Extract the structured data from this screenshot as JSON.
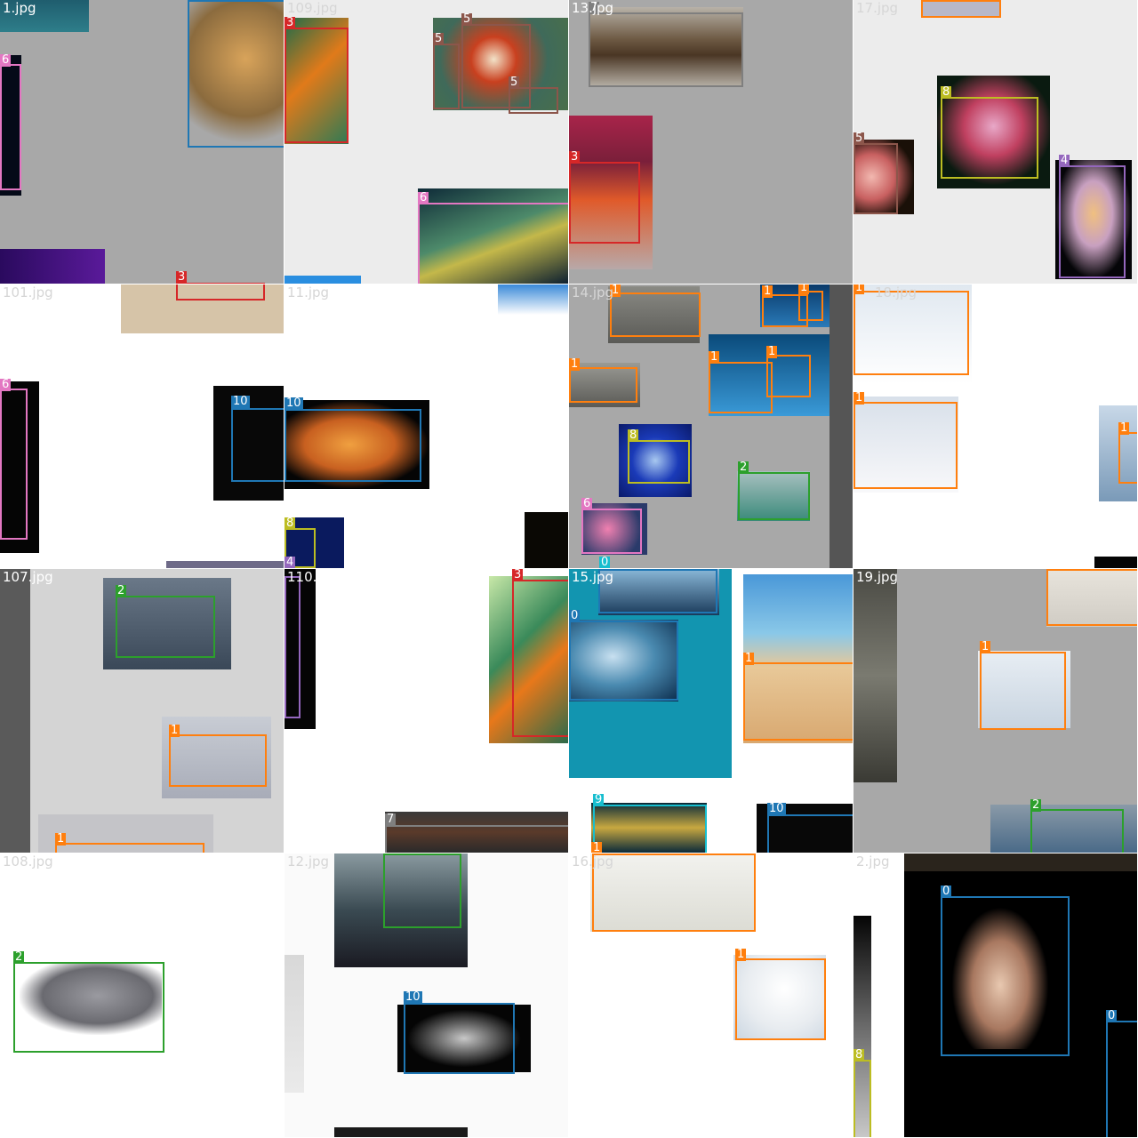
{
  "mosaic": {
    "tiles": [
      {
        "name": "1.jpg"
      },
      {
        "name": "109.jpg"
      },
      {
        "name": "13.jpg"
      },
      {
        "name": "17.jpg"
      },
      {
        "name": "101.jpg"
      },
      {
        "name": "11.jpg"
      },
      {
        "name": "14.jpg"
      },
      {
        "name": "18.jpg"
      },
      {
        "name": "107.jpg"
      },
      {
        "name": "110.jpg"
      },
      {
        "name": "15.jpg"
      },
      {
        "name": "19.jpg"
      },
      {
        "name": "108.jpg"
      },
      {
        "name": "12.jpg"
      },
      {
        "name": "16.jpg"
      },
      {
        "name": "2.jpg"
      }
    ],
    "class_labels": [
      "0",
      "1",
      "2",
      "3",
      "4",
      "5",
      "6",
      "7",
      "8",
      "9",
      "10"
    ],
    "class_colors": [
      "#1f77b4",
      "#ff7f0e",
      "#2ca02c",
      "#d62728",
      "#9467bd",
      "#8c564b",
      "#e377c2",
      "#7f7f7f",
      "#bcbd22",
      "#17becf",
      "#1f77b4"
    ]
  }
}
